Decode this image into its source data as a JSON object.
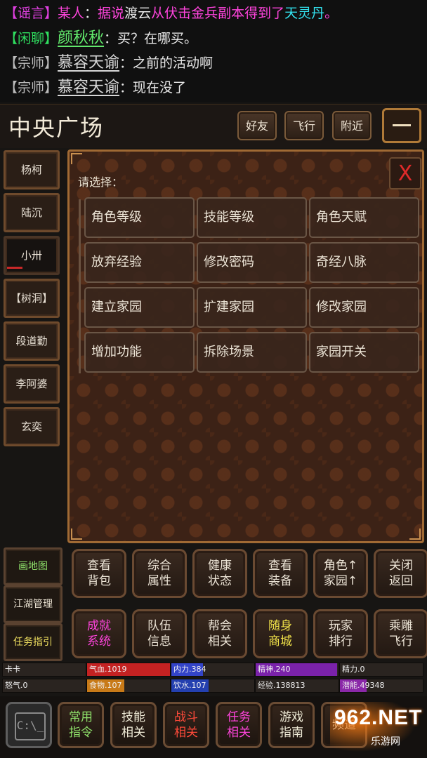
{
  "chat": [
    {
      "tag": "【谣言】",
      "speaker": "某人",
      "sep": "：",
      "parts": [
        {
          "t": "据说",
          "c": "c-pink"
        },
        {
          "t": "渡云",
          "c": "c-white"
        },
        {
          "t": "从伏击金兵副本得到了",
          "c": "c-pink"
        },
        {
          "t": "天灵丹",
          "c": "c-cyan"
        },
        {
          "t": "。",
          "c": "c-pink"
        }
      ]
    },
    {
      "tag": "【闲聊】",
      "speaker": "颜秋秋",
      "sep": "：",
      "message": "买？在哪买。"
    },
    {
      "tag": "【宗师】",
      "speaker": "慕容天谕",
      "sep": "：",
      "message": "之前的活动啊"
    },
    {
      "tag": "【宗师】",
      "speaker": "慕容天谕",
      "sep": "：",
      "message": "现在没了"
    }
  ],
  "header": {
    "location": "中央广场",
    "friends": "好友",
    "fly": "飞行",
    "nearby": "附近",
    "menu_icon": "menu-icon"
  },
  "npcs": [
    "杨柯",
    "陆沉",
    "小卅",
    "【树洞】",
    "段道勤",
    "李阿婆",
    "玄奕"
  ],
  "panel": {
    "close": "X",
    "prompt": "请选择：",
    "options": [
      "角色等级",
      "技能等级",
      "角色天赋",
      "放弃经验",
      "修改密码",
      "奇经八脉",
      "建立家园",
      "扩建家园",
      "修改家园",
      "增加功能",
      "拆除场景",
      "家园开关"
    ]
  },
  "left_buttons": [
    "画地图",
    "江湖管理",
    "任务指引"
  ],
  "actions": [
    "查看\n背包",
    "综合\n属性",
    "健康\n状态",
    "查看\n装备",
    "角色↑\n家园↑",
    "关闭\n返回",
    "成就\n系统",
    "队伍\n信息",
    "帮会\n相关",
    "随身\n商城",
    "玩家\n排行",
    "乘雕\n飞行"
  ],
  "stats": [
    {
      "label": "卡卡",
      "fill": 0,
      "color": "#7a4040"
    },
    {
      "label": "气血.1019",
      "fill": 1.0,
      "color": "#c42222"
    },
    {
      "label": "内力.384",
      "fill": 0.38,
      "color": "#3344c8"
    },
    {
      "label": "精神.240",
      "fill": 0.98,
      "color": "#7a22aa"
    },
    {
      "label": "精力.0",
      "fill": 0,
      "color": "#8a8a8a"
    },
    {
      "label": "怒气.0",
      "fill": 0,
      "color": "#a03030"
    },
    {
      "label": "食物.107",
      "fill": 0.45,
      "color": "#c87a18"
    },
    {
      "label": "饮水.107",
      "fill": 0.45,
      "color": "#2440b0"
    },
    {
      "label": "经验.138813",
      "fill": 0,
      "color": "#b03060"
    },
    {
      "label": "潜能.49348",
      "fill": 0.32,
      "color": "#8a28a8"
    }
  ],
  "bottom_bar": [
    "常用\n指令",
    "技能\n相关",
    "战斗\n相关",
    "任务\n相关",
    "游戏\n指南",
    "频道\n"
  ],
  "console_label": "C:\\_",
  "watermark": {
    "domain": "962.NET",
    "sub": "乐游网"
  }
}
